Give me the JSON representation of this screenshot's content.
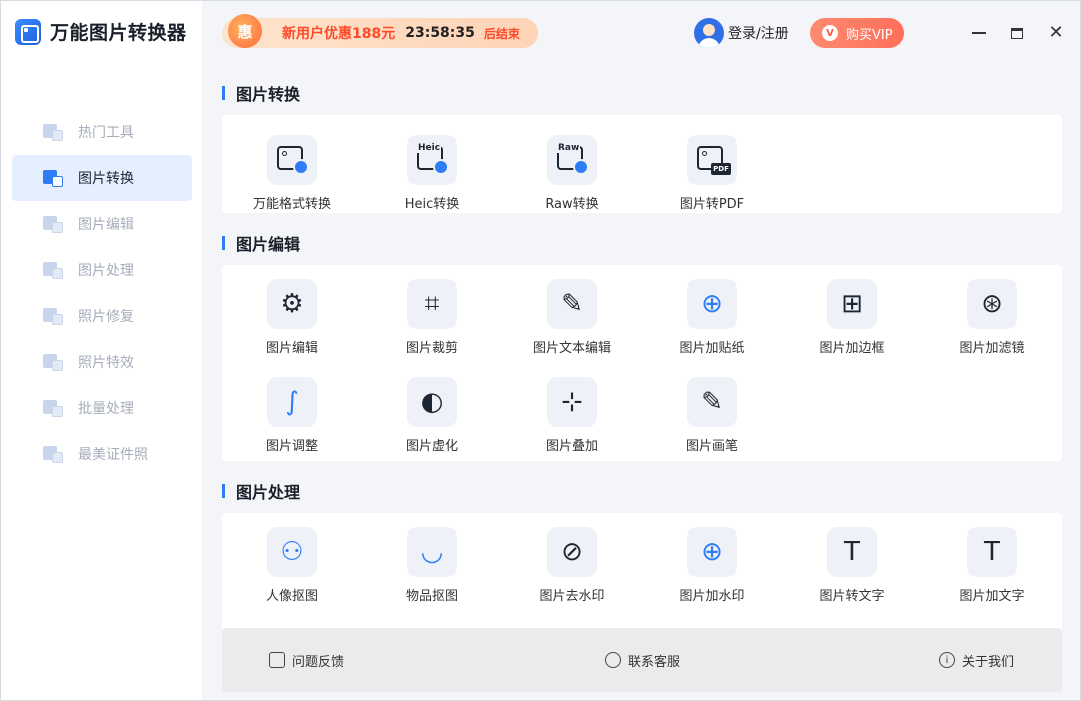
{
  "app": {
    "title": "万能图片转换器"
  },
  "promo": {
    "icon_text": "惠",
    "text": "新用户优惠188元",
    "timer": "23:58:35",
    "suffix": "后结束"
  },
  "account": {
    "login_label": "登录/注册",
    "vip_label": "购买VIP",
    "vip_icon": "V"
  },
  "window_controls": {
    "close_glyph": "✕"
  },
  "sidebar": {
    "items": [
      {
        "label": "热门工具",
        "active": false
      },
      {
        "label": "图片转换",
        "active": true
      },
      {
        "label": "图片编辑",
        "active": false
      },
      {
        "label": "图片处理",
        "active": false
      },
      {
        "label": "照片修复",
        "active": false
      },
      {
        "label": "照片特效",
        "active": false
      },
      {
        "label": "批量处理",
        "active": false
      },
      {
        "label": "最美证件照",
        "active": false
      }
    ]
  },
  "sections": {
    "convert": {
      "title": "图片转换",
      "tools": [
        {
          "label": "万能格式转换",
          "tag": ""
        },
        {
          "label": "Heic转换",
          "tag": "Heic"
        },
        {
          "label": "Raw转换",
          "tag": "Raw"
        },
        {
          "label": "图片转PDF",
          "tag": "PDF"
        }
      ]
    },
    "edit": {
      "title": "图片编辑",
      "tools": [
        {
          "label": "图片编辑",
          "glyph": "⚙"
        },
        {
          "label": "图片裁剪",
          "glyph": "⌗"
        },
        {
          "label": "图片文本编辑",
          "glyph": "✎"
        },
        {
          "label": "图片加贴纸",
          "glyph": "⊕"
        },
        {
          "label": "图片加边框",
          "glyph": "⊞"
        },
        {
          "label": "图片加滤镜",
          "glyph": "⊛"
        },
        {
          "label": "图片调整",
          "glyph": "∫"
        },
        {
          "label": "图片虚化",
          "glyph": "◐"
        },
        {
          "label": "图片叠加",
          "glyph": "⊹"
        },
        {
          "label": "图片画笔",
          "glyph": "✎"
        }
      ]
    },
    "process": {
      "title": "图片处理",
      "tools": [
        {
          "label": "人像抠图",
          "glyph": "⚇"
        },
        {
          "label": "物品抠图",
          "glyph": "◡"
        },
        {
          "label": "图片去水印",
          "glyph": "⊘"
        },
        {
          "label": "图片加水印",
          "glyph": "⊕"
        },
        {
          "label": "图片转文字",
          "glyph": "T"
        },
        {
          "label": "图片加文字",
          "glyph": "T"
        }
      ]
    }
  },
  "footer": {
    "feedback": "问题反馈",
    "support": "联系客服",
    "about": "关于我们",
    "about_glyph": "i"
  }
}
